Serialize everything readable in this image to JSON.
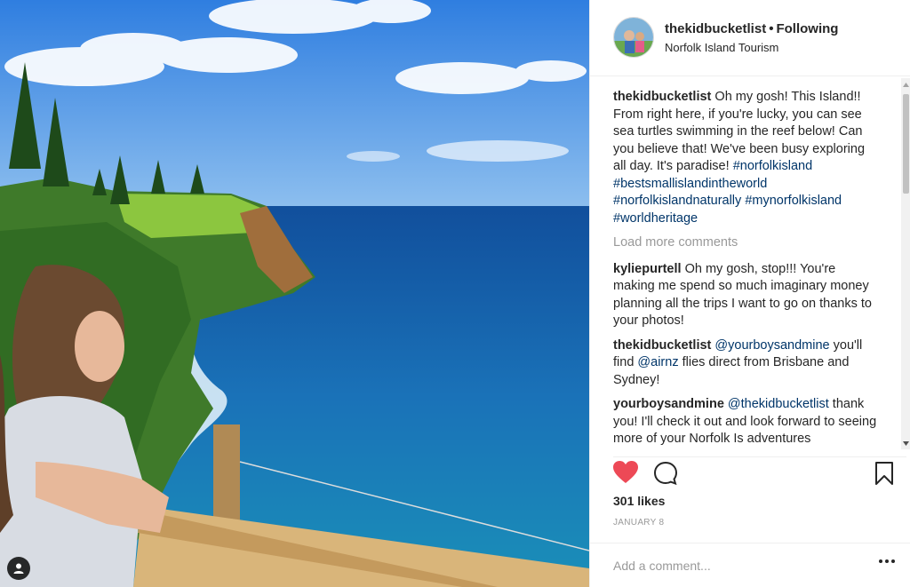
{
  "post": {
    "username": "thekidbucketlist",
    "separator": "•",
    "follow_status": "Following",
    "location": "Norfolk Island Tourism"
  },
  "caption": {
    "user": "thekidbucketlist",
    "text": "Oh my gosh! This Island!! From right here, if you're lucky, you can see sea turtles swimming in the reef below! Can you believe that! We've been busy exploring all day. It's paradise!",
    "hashtags": [
      "#norfolkisland",
      "#bestsmallislandintheworld",
      "#norfolkislandnaturally",
      "#mynorfolkisland",
      "#worldheritage"
    ]
  },
  "load_more": "Load more comments",
  "comments": [
    {
      "user": "kyliepurtell",
      "pre": "Oh my gosh, stop!!! You're making me spend so much imaginary money planning all the trips I want to go on thanks to your photos!",
      "mention": "",
      "post": "",
      "mention2": "",
      "post2": ""
    },
    {
      "user": "thekidbucketlist",
      "pre": "",
      "mention": "@yourboysandmine",
      "post": " you'll find ",
      "mention2": "@airnz",
      "post2": " flies direct from Brisbane and Sydney!"
    },
    {
      "user": "yourboysandmine",
      "pre": "",
      "mention": "@thekidbucketlist",
      "post": " thank you! I'll check it out and look forward to seeing more of your Norfolk Is adventures",
      "mention2": "",
      "post2": ""
    }
  ],
  "likes": "301 likes",
  "date": "JANUARY 8",
  "add_comment": {
    "placeholder": "Add a comment..."
  },
  "icons": {
    "like": "heart-icon",
    "comment": "comment-icon",
    "save": "bookmark-icon",
    "more": "more-options-icon",
    "tagged": "user-tag-icon"
  },
  "colors": {
    "heart": "#ed4956",
    "hashtag": "#003569",
    "muted": "#999999",
    "text": "#262626"
  }
}
